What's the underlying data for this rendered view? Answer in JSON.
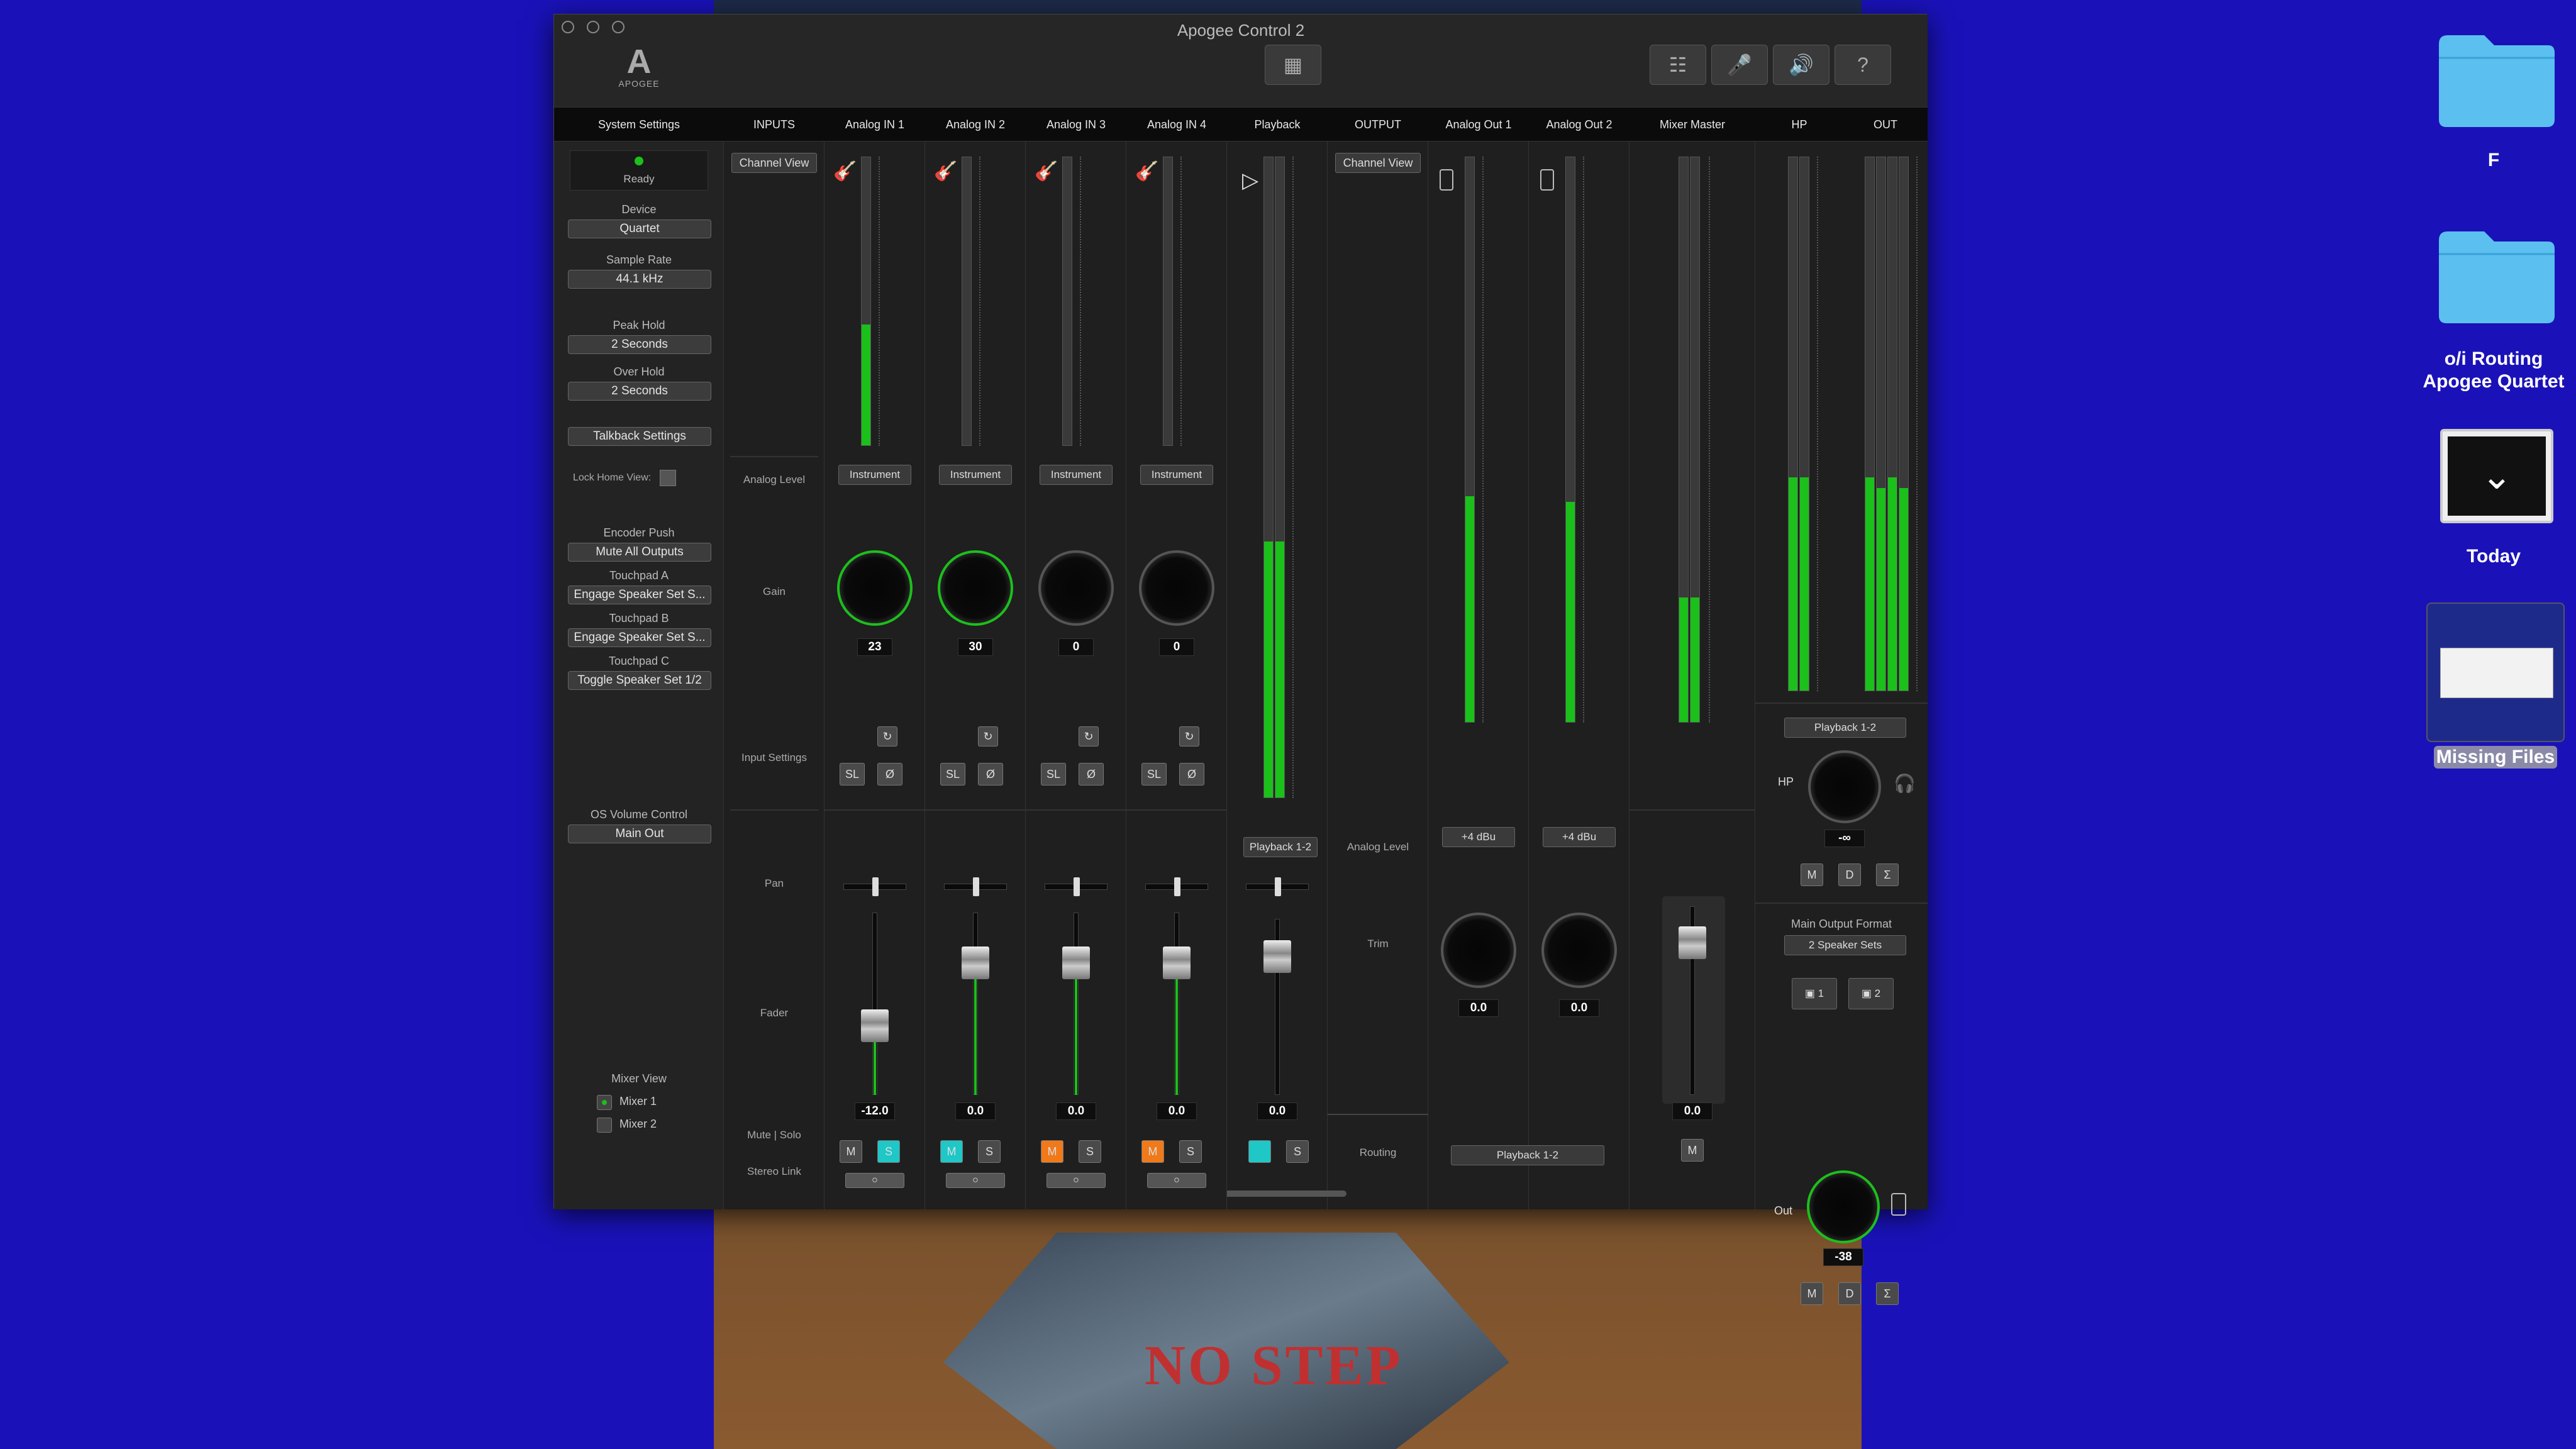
{
  "window": {
    "title": "Apogee Control 2"
  },
  "logo": {
    "letter": "A",
    "text": "APOGEE"
  },
  "header": {
    "system_settings": "System Settings",
    "inputs": "INPUTS",
    "analog_in_1": "Analog IN 1",
    "analog_in_2": "Analog IN 2",
    "analog_in_3": "Analog IN 3",
    "analog_in_4": "Analog IN 4",
    "playback": "Playback",
    "output": "OUTPUT",
    "analog_out_1": "Analog Out 1",
    "analog_out_2": "Analog Out 2",
    "mixer_master": "Mixer Master",
    "hp": "HP",
    "out": "OUT"
  },
  "sidebar": {
    "status": "Ready",
    "device_label": "Device",
    "device_value": "Quartet",
    "sample_rate_label": "Sample Rate",
    "sample_rate_value": "44.1 kHz",
    "peak_hold_label": "Peak Hold",
    "peak_hold_value": "2 Seconds",
    "over_hold_label": "Over Hold",
    "over_hold_value": "2 Seconds",
    "talkback": "Talkback Settings",
    "lock_home": "Lock Home View:",
    "encoder_push_label": "Encoder Push",
    "encoder_push_value": "Mute All Outputs",
    "touchpad_a_label": "Touchpad A",
    "touchpad_a_value": "Engage Speaker Set S...",
    "touchpad_b_label": "Touchpad B",
    "touchpad_b_value": "Engage Speaker Set S...",
    "touchpad_c_label": "Touchpad C",
    "touchpad_c_value": "Toggle Speaker Set 1/2",
    "os_volume_label": "OS Volume Control",
    "os_volume_value": "Main Out",
    "mixer_view_label": "Mixer View",
    "mixer_1": "Mixer 1",
    "mixer_2": "Mixer 2"
  },
  "inputs_labels": {
    "channel_view": "Channel View",
    "analog_level": "Analog Level",
    "gain": "Gain",
    "input_settings": "Input Settings",
    "pan": "Pan",
    "fader": "Fader",
    "mute_solo": "Mute | Solo",
    "stereo_link": "Stereo Link"
  },
  "channels": [
    {
      "level": "Instrument",
      "gain": "23",
      "fader": "-12.0",
      "meter": 0.42,
      "mute": "M",
      "solo": "S",
      "sl": "SL",
      "phase": "Ø"
    },
    {
      "level": "Instrument",
      "gain": "30",
      "fader": "0.0",
      "meter": 0,
      "mute": "M",
      "solo": "S",
      "sl": "SL",
      "phase": "Ø"
    },
    {
      "level": "Instrument",
      "gain": "0",
      "fader": "0.0",
      "meter": 0,
      "mute": "M",
      "solo": "S",
      "sl": "SL",
      "phase": "Ø"
    },
    {
      "level": "Instrument",
      "gain": "0",
      "fader": "0.0",
      "meter": 0,
      "mute": "M",
      "solo": "S",
      "sl": "SL",
      "phase": "Ø"
    }
  ],
  "playback": {
    "source": "Playback 1-2",
    "fader": "0.0",
    "solo": "S",
    "meter": 0.4
  },
  "output": {
    "channel_view": "Channel View",
    "analog_level": "Analog Level",
    "trim": "Trim",
    "routing": "Routing",
    "out1_level": "+4 dBu",
    "out2_level": "+4 dBu",
    "out1_trim": "0.0",
    "out2_trim": "0.0",
    "routing_value": "Playback 1-2",
    "out1_meter": 0.4,
    "out2_meter": 0.39
  },
  "mixer_master": {
    "fader": "0.0",
    "mute": "M",
    "meter": 0.22
  },
  "hp": {
    "source": "Playback 1-2",
    "label": "HP",
    "value": "-∞",
    "m": "M",
    "d": "D",
    "sum": "Σ",
    "main_output_format_label": "Main Output Format",
    "main_output_format_value": "2 Speaker Sets",
    "set1": "1",
    "set2": "2",
    "out_label": "Out",
    "out_value": "-38",
    "m2": "M",
    "d2": "D",
    "sum2": "Σ"
  },
  "desktop": {
    "folder1_label": "F",
    "folder2_label_line1": "o/i Routing",
    "folder2_label_line2": "Apogee Quartet",
    "today_label": "Today",
    "missing_label": "Missing Files"
  },
  "photo_text": "NO STEP",
  "colors": {
    "meter_green": "#1bc01b",
    "solo_cyan": "#1fc7c7",
    "mute_orange": "#f07a1a",
    "desktop_blue": "#1a12b8",
    "folder_blue": "#5bc0f0"
  }
}
